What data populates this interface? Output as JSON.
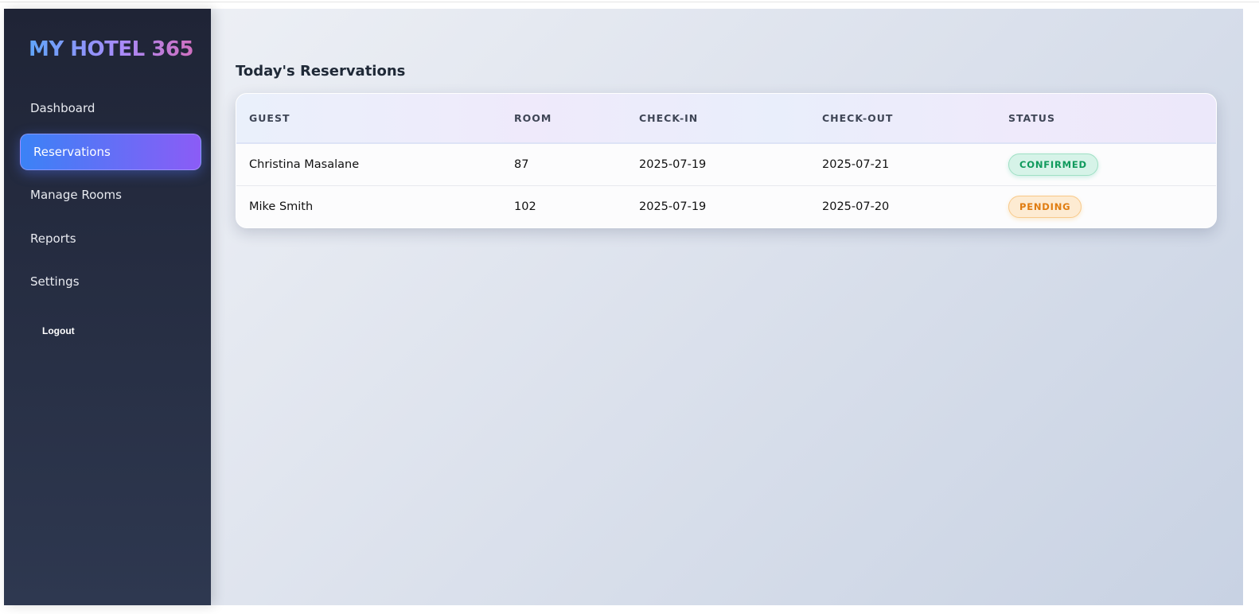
{
  "app": {
    "logo": "MY HOTEL 365"
  },
  "sidebar": {
    "items": [
      {
        "label": "Dashboard"
      },
      {
        "label": "Reservations"
      },
      {
        "label": "Manage Rooms"
      },
      {
        "label": "Reports"
      },
      {
        "label": "Settings"
      }
    ],
    "logout": "Logout",
    "active": "Reservations"
  },
  "main": {
    "title": "Today's Reservations",
    "columns": [
      "GUEST",
      "ROOM",
      "CHECK-IN",
      "CHECK-OUT",
      "STATUS"
    ],
    "rows": [
      {
        "guest": "Christina Masalane",
        "room": "87",
        "checkin": "2025-07-19",
        "checkout": "2025-07-21",
        "status": "CONFIRMED"
      },
      {
        "guest": "Mike Smith",
        "room": "102",
        "checkin": "2025-07-19",
        "checkout": "2025-07-20",
        "status": "PENDING"
      }
    ]
  },
  "colors": {
    "confirmed": "#0f9a5c",
    "pending": "#e07c10",
    "accent": "#3b82f6"
  }
}
